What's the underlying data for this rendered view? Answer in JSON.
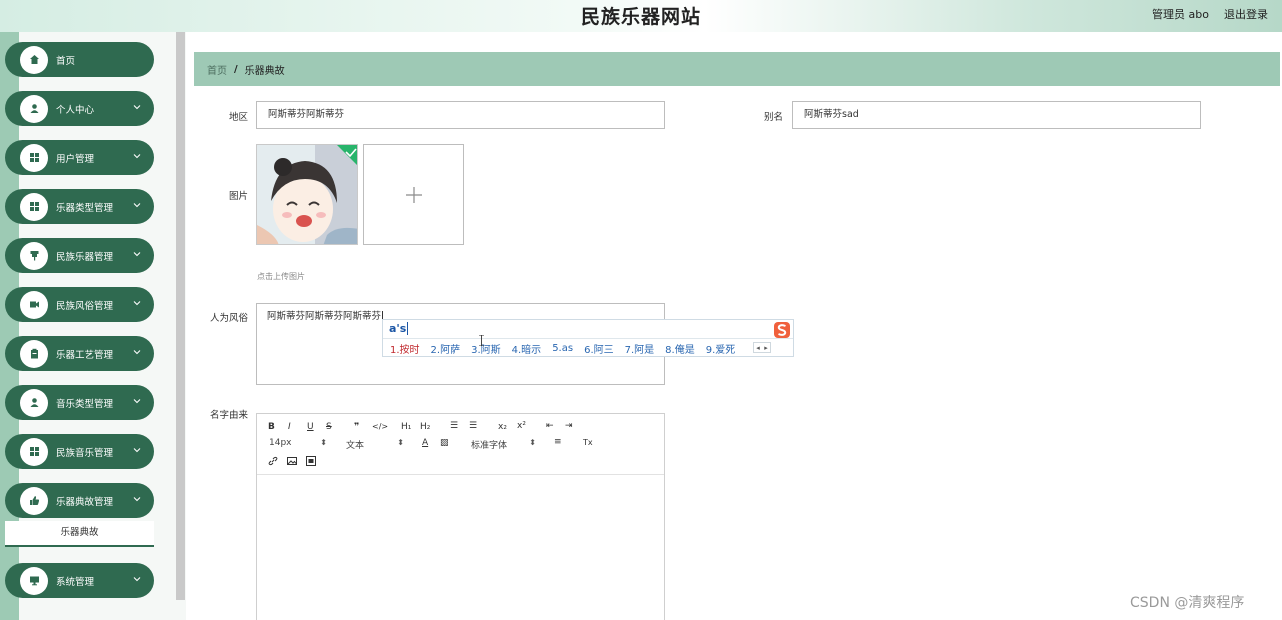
{
  "header": {
    "title": "民族乐器网站",
    "user": "管理员 abo",
    "logout": "退出登录"
  },
  "sidebar": {
    "items": [
      {
        "label": "首页",
        "icon": "home-icon",
        "has_arrow": false
      },
      {
        "label": "个人中心",
        "icon": "user-icon",
        "has_arrow": true
      },
      {
        "label": "用户管理",
        "icon": "grid-icon",
        "has_arrow": true
      },
      {
        "label": "乐器类型管理",
        "icon": "grid-icon",
        "has_arrow": true
      },
      {
        "label": "民族乐器管理",
        "icon": "pin-icon",
        "has_arrow": true
      },
      {
        "label": "民族风俗管理",
        "icon": "video-icon",
        "has_arrow": true
      },
      {
        "label": "乐器工艺管理",
        "icon": "clipboard-icon",
        "has_arrow": true
      },
      {
        "label": "音乐类型管理",
        "icon": "user-icon",
        "has_arrow": true
      },
      {
        "label": "民族音乐管理",
        "icon": "grid-icon",
        "has_arrow": true
      },
      {
        "label": "乐器典故管理",
        "icon": "thumb-icon",
        "has_arrow": true
      },
      {
        "label": "系统管理",
        "icon": "monitor-icon",
        "has_arrow": true
      }
    ],
    "submenu_active": "乐器典故"
  },
  "breadcrumb": {
    "home": "首页",
    "separator": "/",
    "current": "乐器典故"
  },
  "form": {
    "region_label": "地区",
    "region_value": "阿斯蒂芬阿斯蒂芬",
    "alias_label": "别名",
    "alias_value": "阿斯蒂芬sad",
    "image_label": "图片",
    "upload_tip": "点击上传图片",
    "custom_label": "人为风俗",
    "custom_value": "阿斯蒂芬阿斯蒂芬阿斯蒂芬",
    "name_origin_label": "名字由来"
  },
  "ime": {
    "input": "a's",
    "candidates": [
      "1.按时",
      "2.阿萨",
      "3.阿斯",
      "4.暗示",
      "5.as",
      "6.阿三",
      "7.阿是",
      "8.俺是",
      "9.爱死"
    ]
  },
  "editor": {
    "font_size": "14px",
    "text_type": "文本",
    "font_family": "标准字体",
    "buttons": {
      "bold": "B",
      "italic": "I",
      "underline": "U",
      "strike": "S",
      "quote": "❞",
      "code": "</>",
      "h1": "H₁",
      "h2": "H₂",
      "ol": "☰",
      "ul": "☰",
      "sub": "x₂",
      "sup": "x²",
      "outdent": "⇤",
      "indent": "⇥",
      "color": "A",
      "bg": "▨",
      "align": "≡",
      "clean": "Tx"
    }
  },
  "watermark": "CSDN @清爽程序"
}
